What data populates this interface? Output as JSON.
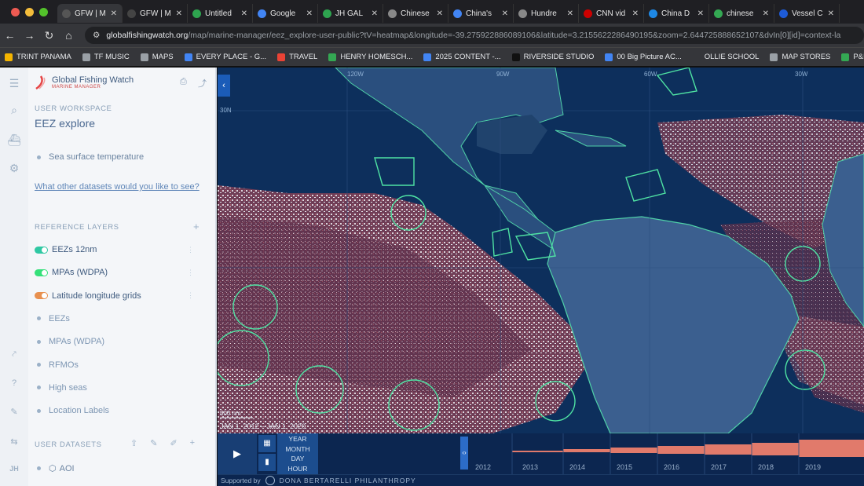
{
  "browser": {
    "tabs": [
      {
        "title": "GFW | M",
        "active": true,
        "color": "#555"
      },
      {
        "title": "GFW | M",
        "color": "#444"
      },
      {
        "title": "Untitled",
        "color": "#2ea44f"
      },
      {
        "title": "Google",
        "color": "#4285f4"
      },
      {
        "title": "JH GAL",
        "color": "#2ea44f"
      },
      {
        "title": "Chinese",
        "color": "#888"
      },
      {
        "title": "China's",
        "color": "#4285f4"
      },
      {
        "title": "Hundre",
        "color": "#888"
      },
      {
        "title": "CNN vid",
        "color": "#cc0000"
      },
      {
        "title": "China D",
        "color": "#1e88e5"
      },
      {
        "title": "chinese",
        "color": "#34a853"
      },
      {
        "title": "Vessel C",
        "color": "#1e5bd6"
      }
    ],
    "url_domain": "globalfishingwatch.org",
    "url_path": "/map/marine-manager/eez_explore-user-public?tV=heatmap&longitude=-39.275922886089106&latitude=3.2155622286490195&zoom=2.644725888652107&dvIn[0][id]=context-la",
    "bookmarks": [
      {
        "label": "TRINT PANAMA",
        "color": "#f4b400"
      },
      {
        "label": "TF MUSIC",
        "color": "#9aa0a6"
      },
      {
        "label": "MAPS",
        "color": "#9aa0a6"
      },
      {
        "label": "EVERY PLACE - G...",
        "color": "#4285f4"
      },
      {
        "label": "TRAVEL",
        "color": "#ea4335"
      },
      {
        "label": "HENRY HOMESCH...",
        "color": "#34a853"
      },
      {
        "label": "2025 CONTENT -...",
        "color": "#4285f4"
      },
      {
        "label": "RIVERSIDE STUDIO",
        "color": "#111"
      },
      {
        "label": "00 Big Picture AC...",
        "color": "#4285f4"
      },
      {
        "label": "OLLIE SCHOOL",
        "color": "#35363a"
      },
      {
        "label": "MAP STORES",
        "color": "#9aa0a6"
      },
      {
        "label": "P&L Simplified",
        "color": "#34a853"
      }
    ]
  },
  "rail": {
    "user_initials": "JH"
  },
  "sidebar": {
    "app_name": "Global Fishing Watch",
    "app_subtitle": "MARINE MANAGER",
    "workspace_label": "USER WORKSPACE",
    "workspace_title": "EEZ explore",
    "env_layer": "Sea surface temperature",
    "request_link": "What other datasets would you like to see?",
    "reference_label": "REFERENCE LAYERS",
    "reference_layers": [
      {
        "label": "EEZs 12nm",
        "toggle": true,
        "color": "#2fc8a3"
      },
      {
        "label": "MPAs (WDPA)",
        "toggle": true,
        "color": "#35e07a"
      },
      {
        "label": "Latitude longitude grids",
        "toggle": true,
        "color": "#e8904f"
      },
      {
        "label": "EEZs",
        "toggle": false
      },
      {
        "label": "MPAs (WDPA)",
        "toggle": false
      },
      {
        "label": "RFMOs",
        "toggle": false
      },
      {
        "label": "High seas",
        "toggle": false
      },
      {
        "label": "Location Labels",
        "toggle": false
      }
    ],
    "user_datasets_label": "USER DATASETS",
    "user_dataset": "AOI"
  },
  "map": {
    "grid_labels": [
      "120W",
      "90W",
      "60W",
      "30W",
      "30N"
    ],
    "scale": "500 nm",
    "date_range": "JAN 1, 2012 – JAN 1, 2020"
  },
  "timebar": {
    "intervals": [
      "YEAR",
      "MONTH",
      "DAY",
      "HOUR"
    ],
    "years": [
      "2012",
      "2013",
      "2014",
      "2015",
      "2016",
      "2017",
      "2018",
      "2019"
    ]
  },
  "footer": {
    "supported_by": "Supported by",
    "sponsor": "DONA BERTARELLI PHILANTHROPY"
  }
}
